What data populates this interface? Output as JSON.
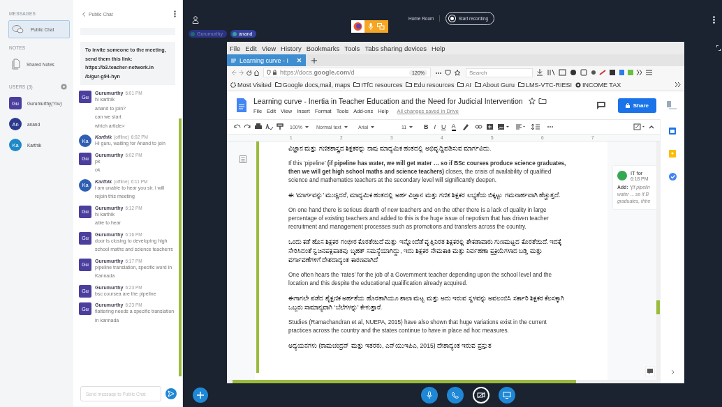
{
  "sidebar": {
    "messages_heading": "MESSAGES",
    "public_chat": {
      "label": "Public Chat",
      "selected": true
    },
    "notes_heading": "NOTES",
    "shared_notes": {
      "label": "Shared Notes",
      "selected": false
    },
    "users_heading": "USERS (3)",
    "users": [
      {
        "initials": "Gu",
        "name": "Gurumurthy",
        "suffix": "(You)",
        "presenter": true,
        "color": "#4b3f9e"
      },
      {
        "initials": "An",
        "name": "anand",
        "presenter": false,
        "color": "#2b3a8c"
      },
      {
        "initials": "Ka",
        "name": "Karthik",
        "presenter": false,
        "color": "#1e88c8"
      }
    ]
  },
  "chat": {
    "title": "Public Chat",
    "invite": "To invite someone to the meeting, send them this link: https://b3.teacher-network.in /b/gur-g94-hyn",
    "messages": [
      {
        "author": "Gurumurthy",
        "initials": "Gu",
        "color": "#4b3f9e",
        "time": "6:01 PM",
        "lines": [
          "hi karthik",
          "anand to join?",
          "can we start",
          "which article>"
        ]
      },
      {
        "author": "Karthik",
        "initials": "Ka",
        "color": "#2f5fb3",
        "status_note": "(offline)",
        "time": "6:02 PM",
        "lines": [
          "Hi guru, waiting for Anand to join"
        ]
      },
      {
        "author": "Gurumurthy",
        "initials": "Gu",
        "color": "#4b3f9e",
        "time": "6:02 PM",
        "lines": [
          "pk",
          "ok"
        ]
      },
      {
        "author": "Karthik",
        "initials": "Ka",
        "color": "#2f5fb3",
        "status_note": "(offline)",
        "time": "6:11 PM",
        "lines": [
          "i am unable to hear you sir. i will rejoin this meeting"
        ]
      },
      {
        "author": "Gurumurthy",
        "initials": "Gu",
        "color": "#4b3f9e",
        "time": "6:12 PM",
        "lines": [
          "hi karthik",
          "able to hear"
        ]
      },
      {
        "author": "Gurumurthy",
        "initials": "Gu",
        "color": "#4b3f9e",
        "time": "6:16 PM",
        "lines": [
          "door is closing to developing high school maths and science teacherrs"
        ]
      },
      {
        "author": "Gurumurthy",
        "initials": "Gu",
        "color": "#4b3f9e",
        "time": "6:17 PM",
        "lines": [
          "pipeline translation, specific word in Kannada"
        ]
      },
      {
        "author": "Gurumurthy",
        "initials": "Gu",
        "color": "#4b3f9e",
        "time": "6:23 PM",
        "lines": [
          "bsc coursea are the pipeline"
        ]
      },
      {
        "author": "Gurumurthy",
        "initials": "Gu",
        "color": "#4b3f9e",
        "time": "6:23 PM",
        "lines": [
          "flattering needs a specific translation in kannada"
        ]
      }
    ],
    "input": {
      "placeholder": "Send message to Public Chat"
    }
  },
  "top_bar": {
    "talkers": [
      {
        "name": "Gurumurthy",
        "talking": false
      },
      {
        "name": "anand",
        "talking": true
      }
    ],
    "room": "Home Room",
    "record_button": "Start recording"
  },
  "browser": {
    "menu": [
      "File",
      "Edit",
      "View",
      "History",
      "Bookmarks",
      "Tools",
      "Tabs sharing devices",
      "Help"
    ],
    "tabs": [
      {
        "label": "Learning curve - I",
        "selected": true
      }
    ],
    "url": "https://docs.**google.com**/d",
    "zoom": "120%",
    "search": {
      "placeholder": "Search"
    },
    "bookmarks": [
      {
        "label": "Most Visited",
        "kind": "gear"
      },
      {
        "label": "Google docs,mail, maps",
        "kind": "folder"
      },
      {
        "label": "ITfC resources",
        "kind": "folder"
      },
      {
        "label": "Edu resources",
        "kind": "folder"
      },
      {
        "label": "AI",
        "kind": "folder"
      },
      {
        "label": "About Guru",
        "kind": "folder"
      },
      {
        "label": "LMS-VTC-RIESI",
        "kind": "folder"
      },
      {
        "label": "INCOME TAX",
        "kind": "globe"
      }
    ]
  },
  "doc": {
    "title": "Learning curve - Inertia in Teacher Education and the Need for Judicial Intervention",
    "menu": [
      "File",
      "Edit",
      "View",
      "Insert",
      "Format",
      "Tools",
      "Add-ons",
      "Help"
    ],
    "save_status": "All changes saved in Drive",
    "share": "Share",
    "toolbar": {
      "zoom": "100%",
      "style": "Normal text",
      "font": "Arial",
      "size": "11",
      "format": [
        {
          "label": "B",
          "kind": "bold"
        },
        {
          "label": "I",
          "kind": "italic"
        },
        {
          "label": "U",
          "kind": "underline"
        },
        {
          "label": "A",
          "kind": "color"
        }
      ]
    },
    "ruler": [
      "1",
      "2",
      "3",
      "4",
      "5",
      "6",
      "7"
    ],
    "paragraphs": [
      {
        "kind": "kannada",
        "text": "ವಿಜ್ಞಾನ ಮತ್ತು ಗಣಿತಶಾಸ್ತ್ರದ ಶಿಕ್ಷಕರನ್ನು ನಾವು ಮಾಧ್ಯಮಿಕ ಹಂತದಲ್ಲಿ ಅಭಿವೃದ್ಧಿಪಡಿಸುವ ಮಾರ್ಗವಿದು."
      },
      {
        "kind": "english",
        "text": "If this ‘pipeline’  **(if pipeline has water, we will get water … so if BSc courses produce science graduates, then we will get high school maths and science teachers)**  closes, the crisis of availability of qualified science and mathematics teachers at the secondary level will significantly deepen."
      },
      {
        "kind": "kannada",
        "text": "ಈ ‘ಮಾರ್ಗವನ್ನು’ ಮುಚ್ಚಿದರೆ, ಮಾಧ್ಯಮಿಕ ಹಂತದಲ್ಲಿ ಅರ್ಹ ವಿಜ್ಞಾನ ಮತ್ತು ಗಣಿತ ಶಿಕ್ಷಕರ ಲಭ್ಯತೆಯ ಬಿಕ್ಕಟ್ಟು ಗಮನಾರ್ಹವಾಗಿ ಹೆಚ್ಚುತ್ತದೆ."
      },
      {
        "kind": "english",
        "text": "On one hand there is serious dearth of new teachers and on the other there is a lack of quality in large percentage of existing teachers and added to this is the huge issue of nepotism that has driven teacher recruitment and management processes such as promotions and transfers across the country."
      },
      {
        "kind": "kannada",
        "text": "ಒಂದು ಕಡೆ ಹೊಸ ಶಿಕ್ಷಕರ ಗಂಭೀರ ಕೊರತೆಯಿದೆ ಮತ್ತು ಇನ್ನೊಂದೆಡೆ ವೃತ್ತಿನಿರತ ಶಿಕ್ಷಕರಲ್ಲಿ ಶೇಕಡಾವಾರು ಗುಣಮಟ್ಟದ ಕೊರತೆಯಿದೆ. ಇದಕ್ಕೆ ಸೇರಿಸಿದಂತೆ ಸ್ವಜನಪಕ್ಷಪಾತವು ಬೃಹತ್ ಸಮಸ್ಯೆಯಾಗಿದ್ದು, ಇದು ಶಿಕ್ಷಕರ ನೇಮಕಾತಿ ಮತ್ತು ನಿರ್ವಹಣಾ ಪ್ರಕ್ರಿಯೆಗಳಾದ ಬಡ್ತಿ ಮತ್ತು ವರ್ಗಾವಣೆಗಳಿಗೆ ದೇಶದಾದ್ಯಂತ ಕಾರಣವಾಗಿದೆ"
      },
      {
        "kind": "english",
        "text": "One often hears the ‘rates’ for the job of a Government teacher depending upon the school level and the location and this despite the educational qualification already acquired."
      },
      {
        "kind": "kannada",
        "text": "ಈಗಾಗಲೇ ಪಡೆದ ಶೈಕ್ಷಣಿಕ ಅರ್ಹತೆಯ ಹೊರತಾಗಿಯೂ ಶಾಲಾ ಮಟ್ಟ ಮತ್ತು ಅದು ಇರುವ ಸ್ಥಳವನ್ನು ಅವಲಂಬಿಸಿ ಸರ್ಕಾರಿ ಶಿಕ್ಷಕರ ಕೆಲಸಕ್ಕಾಗಿ ಒಬ್ಬರು ಸಾಮಾನ್ಯವಾಗಿ ‘ಬೆಲೆಗಳನ್ನು’ ಕೇಳುತ್ತಾರೆ."
      },
      {
        "kind": "english",
        "text": "Studies (Ramachandran et al, NUEPA, 2015) have also shown that huge variations exist in the current practices across the country and the states continue to have in place ad hoc measures."
      },
      {
        "kind": "kannada",
        "text": "ಅಧ್ಯಯನಗಳು (ರಾಮಚಂದ್ರನ್ ಮತ್ತು ಇತರರು, ಎನ್‌ಯುಇಪಿಎ, 2015) ದೇಶಾದ್ಯಂತ ಇರುವ ಪ್ರಸ್ತುತ"
      }
    ],
    "comment": {
      "author": "IT for",
      "time": "6:18 PM",
      "action": "Add:",
      "quote": [
        "“(if pipelin",
        "water ... so if B",
        "graduates, thhe"
      ]
    }
  },
  "controls": [
    {
      "kind": "mic",
      "on": true
    },
    {
      "kind": "phone",
      "on": true
    },
    {
      "kind": "camera",
      "on": false
    },
    {
      "kind": "screen",
      "on": true
    }
  ]
}
